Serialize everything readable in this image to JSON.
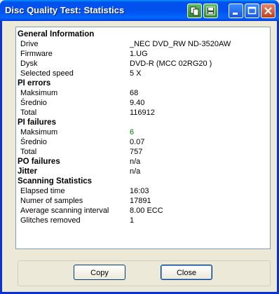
{
  "window": {
    "title": "Disc Quality Test: Statistics"
  },
  "stats": [
    {
      "type": "head",
      "label": "General Information",
      "value": ""
    },
    {
      "type": "sub",
      "label": "Drive",
      "value": "_NEC     DVD_RW ND-3520AW"
    },
    {
      "type": "sub",
      "label": "Firmware",
      "value": "1.UG"
    },
    {
      "type": "sub",
      "label": "Dysk",
      "value": "DVD-R (MCC 02RG20  )"
    },
    {
      "type": "sub",
      "label": "Selected speed",
      "value": "5 X"
    },
    {
      "type": "head",
      "label": "PI errors",
      "value": ""
    },
    {
      "type": "sub",
      "label": "Maksimum",
      "value": "68"
    },
    {
      "type": "sub",
      "label": "Średnio",
      "value": "9.40"
    },
    {
      "type": "sub",
      "label": "Total",
      "value": "116912"
    },
    {
      "type": "head",
      "label": "PI failures",
      "value": ""
    },
    {
      "type": "sub",
      "label": "Maksimum",
      "value": "6",
      "color": "green"
    },
    {
      "type": "sub",
      "label": "Średnio",
      "value": "0.07"
    },
    {
      "type": "sub",
      "label": "Total",
      "value": "757"
    },
    {
      "type": "head",
      "label": "PO failures",
      "value": "n/a"
    },
    {
      "type": "head",
      "label": "Jitter",
      "value": "n/a"
    },
    {
      "type": "head",
      "label": "Scanning Statistics",
      "value": ""
    },
    {
      "type": "sub",
      "label": "Elapsed time",
      "value": "16:03"
    },
    {
      "type": "sub",
      "label": "Numer of samples",
      "value": "17891"
    },
    {
      "type": "sub",
      "label": "Average scanning interval",
      "value": "8.00 ECC"
    },
    {
      "type": "sub",
      "label": "Glitches removed",
      "value": "1"
    }
  ],
  "buttons": {
    "copy": "Copy",
    "close": "Close"
  },
  "colors": {
    "titlebar": "#0050ee",
    "green_value": "#007a00"
  }
}
